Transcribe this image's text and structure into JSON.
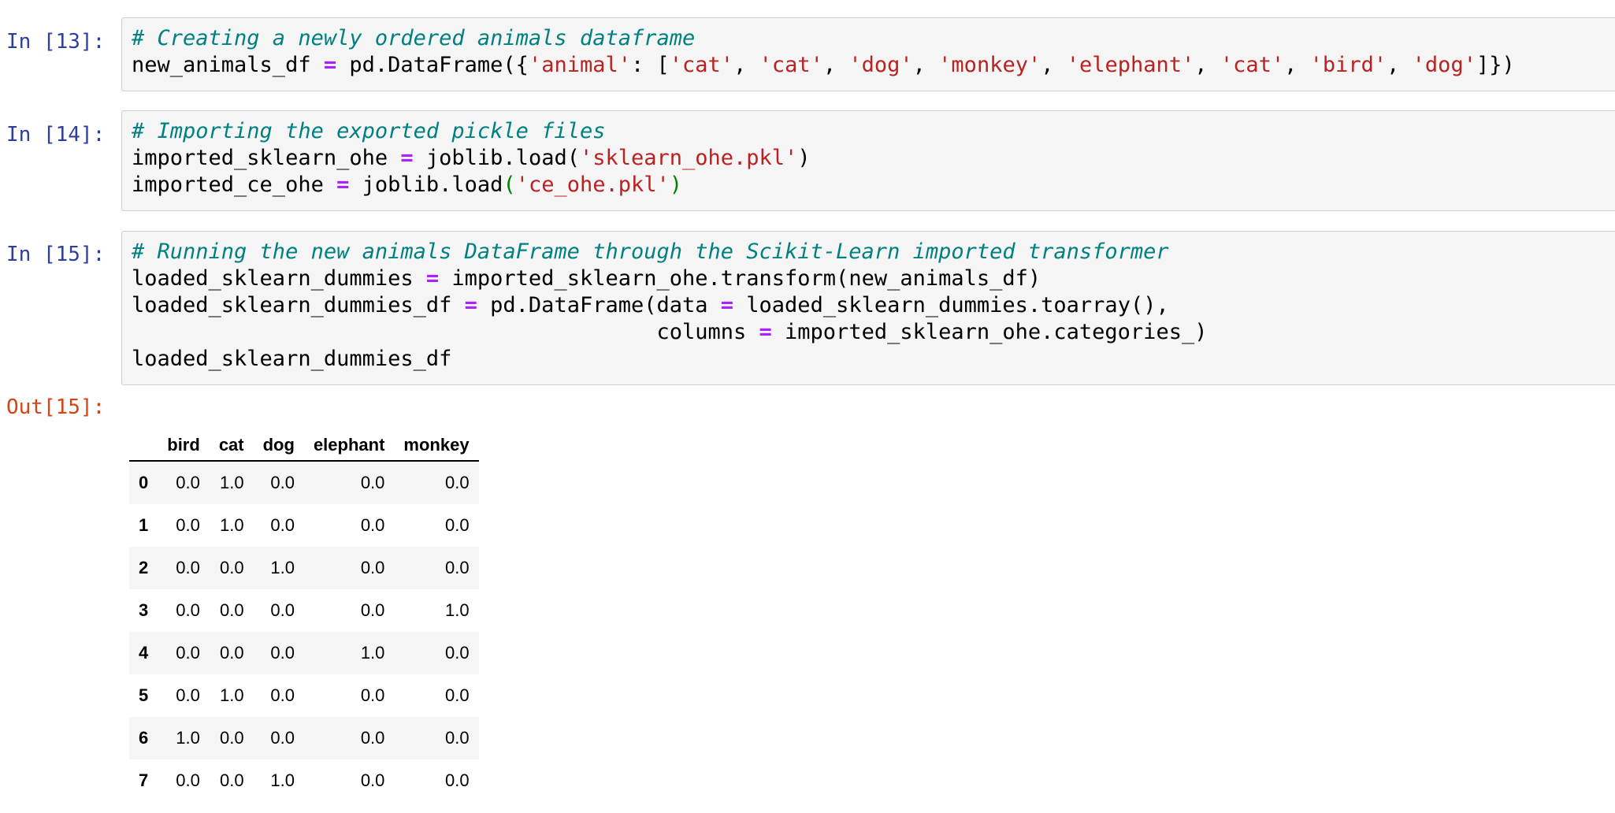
{
  "cells": [
    {
      "prompt": "In [13]:",
      "lines": [
        "# Creating a newly ordered animals dataframe",
        "new_animals_df = pd.DataFrame({'animal': ['cat', 'cat', 'dog', 'monkey', 'elephant', 'cat', 'bird', 'dog']})"
      ]
    },
    {
      "prompt": "In [14]:",
      "lines": [
        "# Importing the exported pickle files",
        "imported_sklearn_ohe = joblib.load('sklearn_ohe.pkl')",
        "imported_ce_ohe = joblib.load('ce_ohe.pkl')"
      ]
    },
    {
      "prompt": "In [15]:",
      "lines": [
        "# Running the new animals DataFrame through the Scikit-Learn imported transformer",
        "loaded_sklearn_dummies = imported_sklearn_ohe.transform(new_animals_df)",
        "loaded_sklearn_dummies_df = pd.DataFrame(data = loaded_sklearn_dummies.toarray(),",
        "                                         columns = imported_sklearn_ohe.categories_)",
        "loaded_sklearn_dummies_df"
      ]
    }
  ],
  "output": {
    "prompt": "Out[15]:",
    "columns": [
      "bird",
      "cat",
      "dog",
      "elephant",
      "monkey"
    ],
    "rows": [
      {
        "index": "0",
        "values": [
          "0.0",
          "1.0",
          "0.0",
          "0.0",
          "0.0"
        ]
      },
      {
        "index": "1",
        "values": [
          "0.0",
          "1.0",
          "0.0",
          "0.0",
          "0.0"
        ]
      },
      {
        "index": "2",
        "values": [
          "0.0",
          "0.0",
          "1.0",
          "0.0",
          "0.0"
        ]
      },
      {
        "index": "3",
        "values": [
          "0.0",
          "0.0",
          "0.0",
          "0.0",
          "1.0"
        ]
      },
      {
        "index": "4",
        "values": [
          "0.0",
          "0.0",
          "0.0",
          "1.0",
          "0.0"
        ]
      },
      {
        "index": "5",
        "values": [
          "0.0",
          "1.0",
          "0.0",
          "0.0",
          "0.0"
        ]
      },
      {
        "index": "6",
        "values": [
          "1.0",
          "0.0",
          "0.0",
          "0.0",
          "0.0"
        ]
      },
      {
        "index": "7",
        "values": [
          "0.0",
          "0.0",
          "1.0",
          "0.0",
          "0.0"
        ]
      }
    ]
  },
  "colors": {
    "prompt_in": "#303f9f",
    "prompt_out": "#d84315",
    "comment": "#008080",
    "operator": "#aa22ff",
    "string": "#ba2121",
    "string_green": "#008000",
    "cell_bg": "#f5f5f5"
  }
}
